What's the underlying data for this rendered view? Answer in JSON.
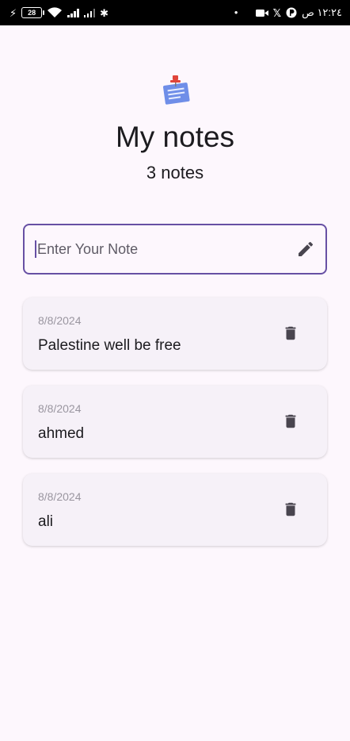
{
  "status_bar": {
    "battery_level": "28",
    "time": "١٢:٢٤ ص",
    "icons": [
      "charging-bolt-icon",
      "wifi-icon",
      "signal-icon",
      "signal-icon",
      "bluetooth-icon",
      "dot-icon",
      "video-camera-icon",
      "x-icon",
      "app-notification-icon"
    ]
  },
  "header": {
    "logo_icon": "pinned-note-icon",
    "title": "My notes",
    "count_label": "3 notes"
  },
  "input": {
    "placeholder": "Enter Your Note",
    "value": "",
    "action_icon": "pencil-icon"
  },
  "notes": [
    {
      "date": "8/8/2024",
      "text": "Palestine well be free",
      "action_icon": "trash-icon"
    },
    {
      "date": "8/8/2024",
      "text": "ahmed",
      "action_icon": "trash-icon"
    },
    {
      "date": "8/8/2024",
      "text": "ali",
      "action_icon": "trash-icon"
    }
  ],
  "colors": {
    "background": "#fdf7fd",
    "accent": "#6750a4",
    "card": "#f6f1f8",
    "icon": "#49454f"
  }
}
